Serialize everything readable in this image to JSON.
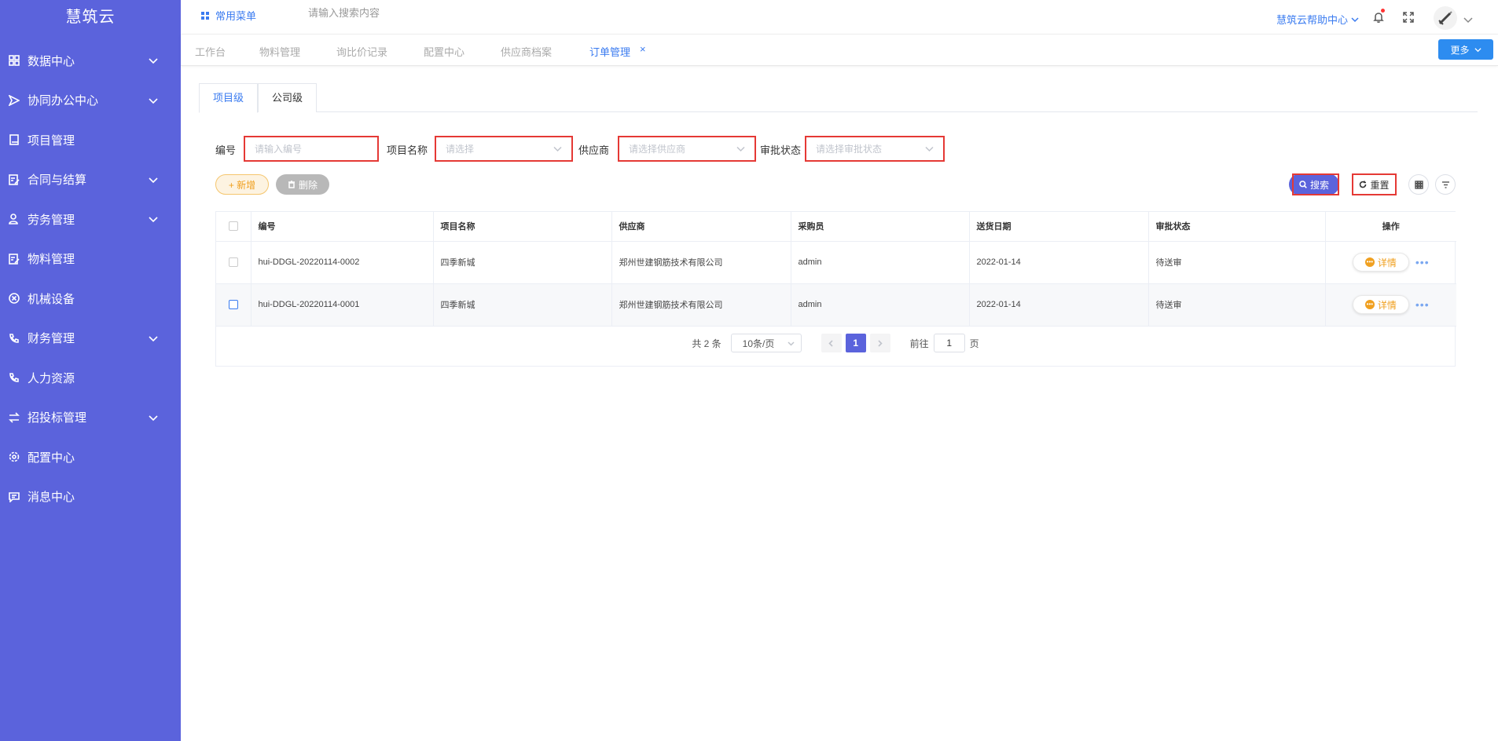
{
  "app": {
    "logo": "慧筑云"
  },
  "sidebar": {
    "items": [
      {
        "label": "数据中心",
        "icon": "grid-icon",
        "has_children": true
      },
      {
        "label": "协同办公中心",
        "icon": "send-icon",
        "has_children": true
      },
      {
        "label": "项目管理",
        "icon": "book-icon",
        "has_children": false
      },
      {
        "label": "合同与结算",
        "icon": "edit-doc-icon",
        "has_children": true
      },
      {
        "label": "劳务管理",
        "icon": "user-icon",
        "has_children": true
      },
      {
        "label": "物料管理",
        "icon": "edit-doc-icon",
        "has_children": false
      },
      {
        "label": "机械设备",
        "icon": "circle-x-icon",
        "has_children": false
      },
      {
        "label": "财务管理",
        "icon": "phone-icon",
        "has_children": true
      },
      {
        "label": "人力资源",
        "icon": "phone-icon",
        "has_children": false
      },
      {
        "label": "招投标管理",
        "icon": "swap-icon",
        "has_children": true
      },
      {
        "label": "配置中心",
        "icon": "gear-icon",
        "has_children": false
      },
      {
        "label": "消息中心",
        "icon": "message-icon",
        "has_children": false
      }
    ]
  },
  "topbar": {
    "common_menu": "常用菜单",
    "search_placeholder": "请输入搜索内容",
    "help_center": "慧筑云帮助中心"
  },
  "page_tabs": {
    "items": [
      "工作台",
      "物料管理",
      "询比价记录",
      "配置中心",
      "供应商档案",
      "订单管理"
    ],
    "close_glyph": "×",
    "more": "更多"
  },
  "level_tabs": [
    "项目级",
    "公司级"
  ],
  "filters": {
    "code": {
      "label": "编号",
      "placeholder": "请输入编号"
    },
    "project": {
      "label": "项目名称",
      "placeholder": "请选择"
    },
    "supplier": {
      "label": "供应商",
      "placeholder": "请选择供应商"
    },
    "status": {
      "label": "审批状态",
      "placeholder": "请选择审批状态"
    }
  },
  "actions": {
    "add": "+ 新增",
    "delete": "删除",
    "search": "搜索",
    "reset": "重置"
  },
  "table": {
    "columns": [
      "编号",
      "项目名称",
      "供应商",
      "采购员",
      "送货日期",
      "审批状态",
      "操作"
    ],
    "rows": [
      {
        "code": "hui-DDGL-20220114-0002",
        "project": "四季新城",
        "supplier": "郑州世建钢筋技术有限公司",
        "buyer": "admin",
        "date": "2022-01-14",
        "status": "待送审",
        "action": "详情"
      },
      {
        "code": "hui-DDGL-20220114-0001",
        "project": "四季新城",
        "supplier": "郑州世建钢筋技术有限公司",
        "buyer": "admin",
        "date": "2022-01-14",
        "status": "待送审",
        "action": "详情"
      }
    ],
    "more_glyph": "•••"
  },
  "pagination": {
    "total": "共 2 条",
    "page_size": "10条/页",
    "current": "1",
    "goto_prefix": "前往",
    "goto_value": "1",
    "goto_suffix": "页"
  },
  "colors": {
    "sidebar_bg": "#5b63dc",
    "primary": "#3a7bf0",
    "highlight_border": "#e53935",
    "warning": "#f0a020"
  }
}
